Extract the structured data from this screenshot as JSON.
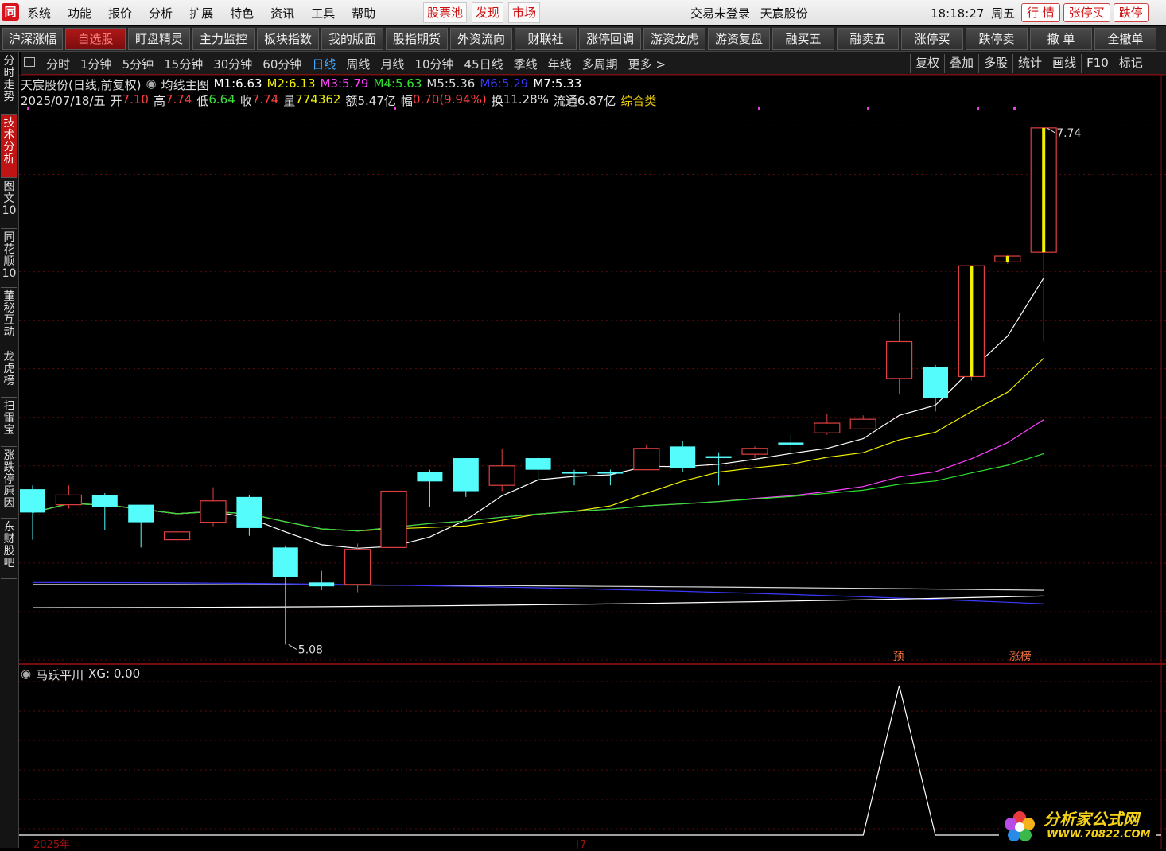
{
  "app": {
    "logo_text": "同"
  },
  "menu": [
    "系统",
    "功能",
    "报价",
    "分析",
    "扩展",
    "特色",
    "资讯",
    "工具",
    "帮助"
  ],
  "menu_right": [
    "股票池",
    "发现",
    "市场"
  ],
  "status": {
    "login": "交易未登录",
    "stock_name": "天宸股份",
    "time": "18:18:27",
    "weekday": "周五"
  },
  "hq_buttons": [
    "行 情",
    "张停买",
    "跌停"
  ],
  "toolbar": [
    "沪深涨幅",
    "自选股",
    "盯盘精灵",
    "主力监控",
    "板块指数",
    "我的版面",
    "股指期货",
    "外资流向",
    "财联社",
    "涨停回调",
    "游资龙虎",
    "游资复盘",
    "融买五",
    "融卖五",
    "涨停买",
    "跌停卖",
    "撤 单",
    "全撤单"
  ],
  "toolbar_active": 1,
  "side_tabs": [
    "分时走势",
    "技术分析",
    "图文10",
    "同花顺10",
    "董秘互动",
    "龙虎榜",
    "扫雷宝",
    "涨跌停原因",
    "东财股吧"
  ],
  "side_active": 1,
  "periods": [
    "分时",
    "1分钟",
    "5分钟",
    "15分钟",
    "30分钟",
    "60分钟",
    "日线",
    "周线",
    "月线",
    "10分钟",
    "45日线",
    "季线",
    "年线",
    "多周期",
    "更多 >"
  ],
  "period_active": 6,
  "right_buttons": [
    "复权",
    "叠加",
    "多股",
    "统计",
    "画线",
    "F10",
    "标记"
  ],
  "info_line1": {
    "title": "天宸股份(日线,前复权)",
    "indicator": "均线主图",
    "ma": [
      {
        "label": "M1:",
        "value": "6.63",
        "color": "#ffffff"
      },
      {
        "label": "M2:",
        "value": "6.13",
        "color": "#f0f000"
      },
      {
        "label": "M3:",
        "value": "5.79",
        "color": "#ff40ff"
      },
      {
        "label": "M4:",
        "value": "5.63",
        "color": "#30e030"
      },
      {
        "label": "M5:",
        "value": "5.36",
        "color": "#d8d8d8"
      },
      {
        "label": "M6:",
        "value": "5.29",
        "color": "#3a3aff"
      },
      {
        "label": "M7:",
        "value": "5.33",
        "color": "#ffffff"
      }
    ]
  },
  "info_line2": {
    "date": "2025/07/18/五",
    "open_label": "开",
    "open": "7.10",
    "high_label": "高",
    "high": "7.74",
    "low_label": "低",
    "low": "6.64",
    "close_label": "收",
    "close": "7.74",
    "vol_label": "量",
    "vol": "774362",
    "amount_label": "额",
    "amount": "5.47亿",
    "change_label": "幅",
    "change": "0.70(9.94%)",
    "turnover_label": "换",
    "turnover": "11.28%",
    "float_label": "流通",
    "float_cap": "6.87亿",
    "category": "综合类"
  },
  "chart_labels": {
    "max_price": "7.74",
    "min_price": "5.08",
    "pre_tag": "预",
    "limit_tag": "涨榜"
  },
  "indicator_panel": {
    "name": "马跃平川",
    "value_text": "XG: 0.00",
    "x_label_left": "2025年",
    "x_label_mid": "7"
  },
  "watermark": {
    "title": "分析家公式网",
    "url": "WWW.70822.COM"
  },
  "colors": {
    "up": "#e04040",
    "down": "#54fcfc",
    "limit_body": "#f0f000",
    "accent_red": "#c01414"
  },
  "chart_data": {
    "type": "candlestick",
    "title": "天宸股份(日线,前复权)",
    "candles": [
      {
        "o": 5.88,
        "c": 5.76,
        "h": 5.9,
        "l": 5.62
      },
      {
        "o": 5.8,
        "c": 5.85,
        "h": 5.9,
        "l": 5.78
      },
      {
        "o": 5.85,
        "c": 5.79,
        "h": 5.86,
        "l": 5.67
      },
      {
        "o": 5.8,
        "c": 5.71,
        "h": 5.8,
        "l": 5.58
      },
      {
        "o": 5.62,
        "c": 5.66,
        "h": 5.68,
        "l": 5.6
      },
      {
        "o": 5.71,
        "c": 5.82,
        "h": 5.89,
        "l": 5.69
      },
      {
        "o": 5.84,
        "c": 5.68,
        "h": 5.85,
        "l": 5.64
      },
      {
        "o": 5.58,
        "c": 5.43,
        "h": 5.59,
        "l": 5.08
      },
      {
        "o": 5.4,
        "c": 5.38,
        "h": 5.46,
        "l": 5.36
      },
      {
        "o": 5.39,
        "c": 5.57,
        "h": 5.6,
        "l": 5.35
      },
      {
        "o": 5.58,
        "c": 5.87,
        "h": 5.87,
        "l": 5.58
      },
      {
        "o": 5.97,
        "c": 5.92,
        "h": 5.98,
        "l": 5.79
      },
      {
        "o": 6.04,
        "c": 5.87,
        "h": 6.04,
        "l": 5.84
      },
      {
        "o": 5.9,
        "c": 6.0,
        "h": 6.09,
        "l": 5.87
      },
      {
        "o": 6.04,
        "c": 5.98,
        "h": 6.05,
        "l": 5.93
      },
      {
        "o": 5.97,
        "c": 5.96,
        "h": 5.98,
        "l": 5.9
      },
      {
        "o": 5.97,
        "c": 5.96,
        "h": 5.98,
        "l": 5.9
      },
      {
        "o": 5.98,
        "c": 6.09,
        "h": 6.11,
        "l": 5.99
      },
      {
        "o": 6.1,
        "c": 5.99,
        "h": 6.13,
        "l": 5.97
      },
      {
        "o": 6.05,
        "c": 6.04,
        "h": 6.07,
        "l": 5.9
      },
      {
        "o": 6.06,
        "c": 6.09,
        "h": 6.1,
        "l": 6.04
      },
      {
        "o": 6.12,
        "c": 6.11,
        "h": 6.16,
        "l": 6.07
      },
      {
        "o": 6.17,
        "c": 6.22,
        "h": 6.27,
        "l": 6.16
      },
      {
        "o": 6.19,
        "c": 6.24,
        "h": 6.26,
        "l": 6.19
      },
      {
        "o": 6.45,
        "c": 6.64,
        "h": 6.79,
        "l": 6.37
      },
      {
        "o": 6.51,
        "c": 6.35,
        "h": 6.52,
        "l": 6.28
      },
      {
        "o": 6.46,
        "c": 7.03,
        "h": 7.03,
        "l": 6.44
      },
      {
        "o": 7.05,
        "c": 7.08,
        "h": 7.09,
        "l": 7.04
      },
      {
        "o": 7.1,
        "c": 7.74,
        "h": 7.74,
        "l": 6.64
      }
    ],
    "limit_up_indices": [
      26,
      28
    ],
    "ylim": [
      5.0,
      7.85
    ],
    "indicator": {
      "name": "马跃平川",
      "values": [
        0,
        0,
        0,
        0,
        0,
        0,
        0,
        0,
        0,
        0,
        0,
        0,
        0,
        0,
        0,
        0,
        0,
        0,
        0,
        0,
        0,
        0,
        0,
        0,
        1,
        0,
        0,
        0,
        0
      ]
    }
  }
}
